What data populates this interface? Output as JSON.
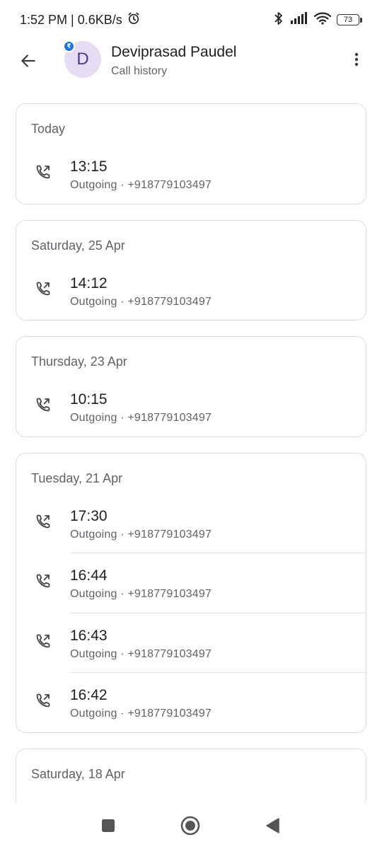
{
  "status_bar": {
    "time_speed": "1:52 PM | 0.6KB/s",
    "battery": "73"
  },
  "header": {
    "avatar_letter": "D",
    "badge_symbol": "₹",
    "contact_name": "Deviprasad Paudel",
    "subtitle": "Call history"
  },
  "groups": [
    {
      "date": "Today",
      "calls": [
        {
          "time": "13:15",
          "detail": "Outgoing · +918779103497"
        }
      ]
    },
    {
      "date": "Saturday, 25 Apr",
      "calls": [
        {
          "time": "14:12",
          "detail": "Outgoing · +918779103497"
        }
      ]
    },
    {
      "date": "Thursday, 23 Apr",
      "calls": [
        {
          "time": "10:15",
          "detail": "Outgoing · +918779103497"
        }
      ]
    },
    {
      "date": "Tuesday, 21 Apr",
      "calls": [
        {
          "time": "17:30",
          "detail": "Outgoing · +918779103497"
        },
        {
          "time": "16:44",
          "detail": "Outgoing · +918779103497"
        },
        {
          "time": "16:43",
          "detail": "Outgoing · +918779103497"
        },
        {
          "time": "16:42",
          "detail": "Outgoing · +918779103497"
        }
      ]
    },
    {
      "date": "Saturday, 18 Apr",
      "calls": []
    }
  ],
  "icons": {
    "back": "arrow-back-icon",
    "more": "more-vert-icon",
    "call": "outgoing-call-icon",
    "nav_recents": "square-icon",
    "nav_home": "circle-icon",
    "nav_back": "triangle-icon"
  },
  "colors": {
    "avatar_bg": "#e6dcf4",
    "avatar_text": "#4c3a86",
    "badge": "#1a73e8",
    "card_border": "#dadce0",
    "secondary_text": "#5f6368"
  }
}
